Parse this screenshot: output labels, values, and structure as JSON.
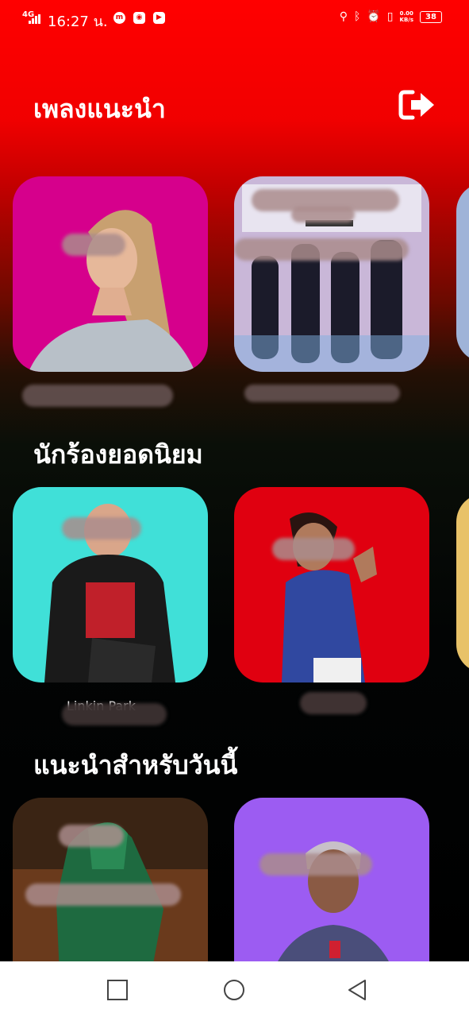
{
  "status_bar": {
    "network": "4G",
    "time": "16:27 น.",
    "data_rate_value": "0.00",
    "data_rate_unit": "KB/s",
    "battery": "38"
  },
  "header": {
    "title": "เพลงแนะนำ"
  },
  "sections": {
    "recommended": {
      "items": [
        {
          "label": "",
          "background": "#d6008c"
        },
        {
          "label": "",
          "background": "#c9b7d8"
        }
      ],
      "peek_background": "#9fb3d8"
    },
    "popular_artists": {
      "title": "นักร้องยอดนิยม",
      "items": [
        {
          "label": "Linkin Park",
          "background": "#40e0d8"
        },
        {
          "label": "",
          "background": "#e00010"
        }
      ],
      "peek_background": "#e8c268"
    },
    "today": {
      "title": "แนะนำสำหรับวันนี้",
      "items": [
        {
          "label": "",
          "background": "#3a2414"
        },
        {
          "label": "",
          "background": "#9c5cf2"
        }
      ]
    }
  },
  "colors": {
    "top_red": "#ff0000",
    "bottom_black": "#000000",
    "navbar": "#ffffff",
    "nav_icon": "#444444"
  },
  "icons": {
    "logout": "logout-icon",
    "nav_recent": "square-icon",
    "nav_home": "circle-icon",
    "nav_back": "triangle-back-icon"
  }
}
